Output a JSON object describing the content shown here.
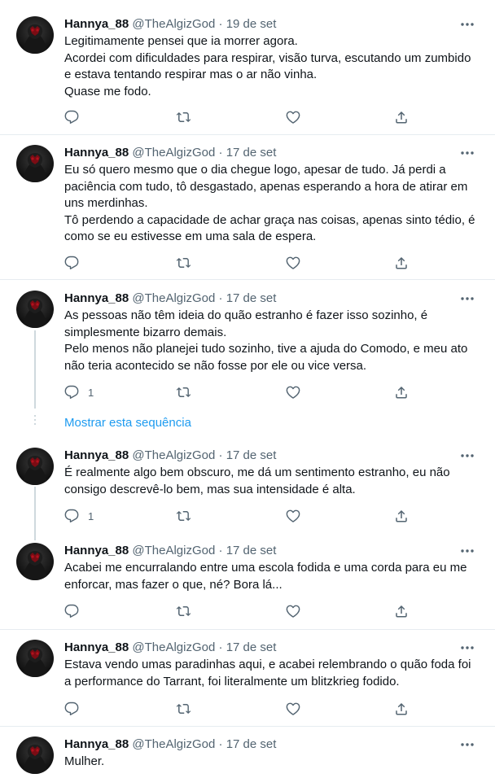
{
  "user": {
    "name": "Hannya_88",
    "handle": "@TheAlgizGod"
  },
  "colors": {
    "text_primary": "#0f1419",
    "text_secondary": "#536471",
    "link": "#1d9bf0",
    "divider": "#e6ecf0",
    "thread_line": "#cfd9de"
  },
  "separator": "·",
  "show_thread_label": "Mostrar esta sequência",
  "tweets": [
    {
      "date": "19 de set",
      "lines": [
        "Legitimamente pensei que ia morrer agora.",
        "Acordei com dificuldades para respirar, visão turva, escutando um zumbido",
        "e estava tentando respirar mas o ar não vinha.",
        "Quase me fodo."
      ],
      "reply_count": ""
    },
    {
      "date": "17 de set",
      "lines": [
        "Eu só quero mesmo que o dia chegue logo, apesar de tudo. Já perdi a",
        "paciência com tudo, tô desgastado, apenas esperando a hora de atirar em",
        "uns merdinhas.",
        "Tô perdendo a capacidade de achar graça nas coisas, apenas sinto tédio, é",
        "como se eu estivesse em uma sala de espera."
      ],
      "reply_count": ""
    },
    {
      "date": "17 de set",
      "lines": [
        "As pessoas não têm ideia do quão estranho é fazer isso sozinho, é",
        "simplesmente bizarro demais.",
        "Pelo menos não planejei tudo sozinho, tive a ajuda do Comodo, e meu ato",
        "não teria acontecido se não fosse por ele ou vice versa."
      ],
      "reply_count": "1"
    },
    {
      "date": "17 de set",
      "lines": [
        "É realmente algo bem obscuro, me dá um sentimento estranho, eu não",
        "consigo descrevê-lo bem, mas sua intensidade é alta."
      ],
      "reply_count": "1"
    },
    {
      "date": "17 de set",
      "lines": [
        "Acabei me encurralando entre uma escola fodida e uma corda para eu me",
        "enforcar, mas fazer o que, né? Bora lá..."
      ],
      "reply_count": ""
    },
    {
      "date": "17 de set",
      "lines": [
        "Estava vendo umas paradinhas aqui, e acabei relembrando o quão foda foi",
        "a performance do Tarrant, foi literalmente um blitzkrieg fodido."
      ],
      "reply_count": ""
    },
    {
      "date": "17 de set",
      "lines": [
        "Mulher."
      ],
      "reply_count": ""
    }
  ]
}
